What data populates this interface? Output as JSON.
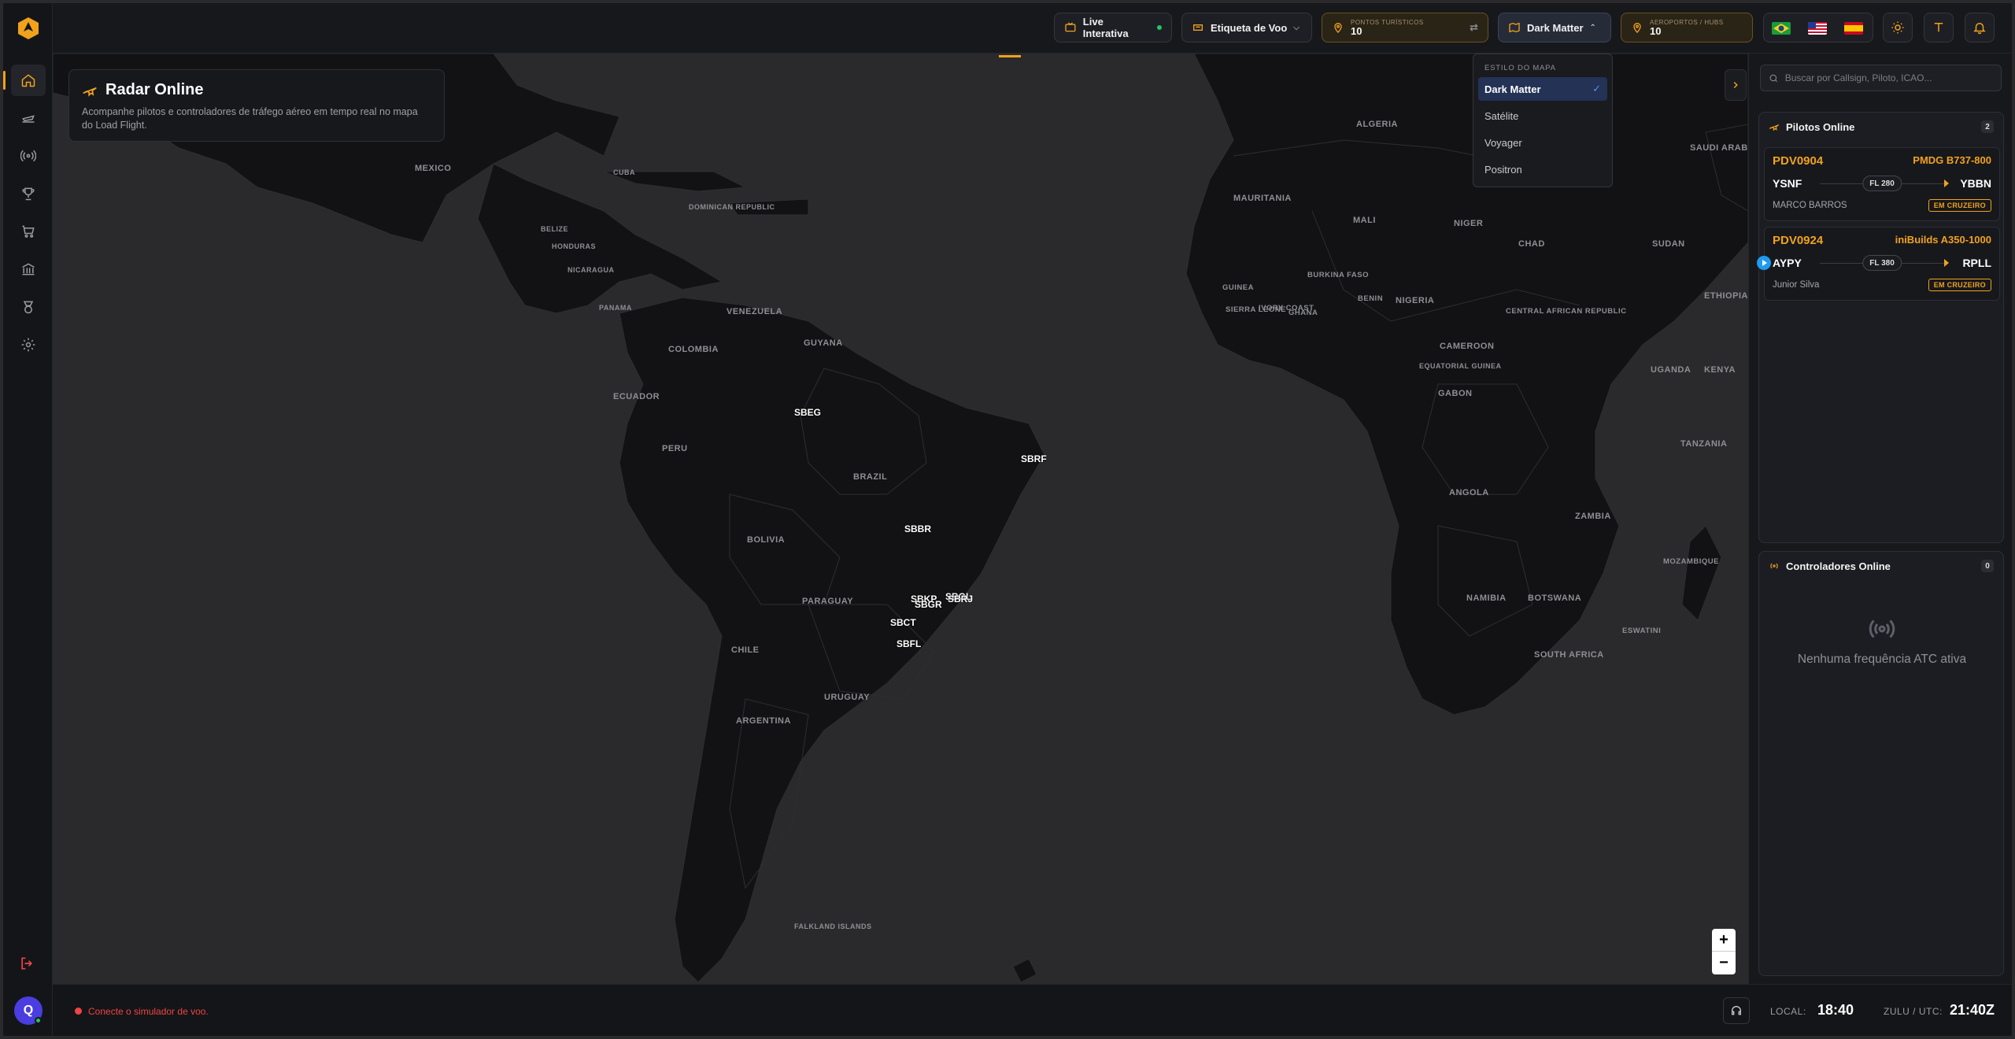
{
  "topbar": {
    "live_label": "Live Interativa",
    "tag_label": "Etiqueta de Voo",
    "tourist_label": "PONTOS TURÍSTICOS",
    "tourist_count": "10",
    "map_style_label": "Dark Matter",
    "airports_label": "AEROPORTOS / HUBS",
    "airports_count": "10"
  },
  "map_style_menu": {
    "header": "ESTILO DO MAPA",
    "options": [
      "Dark Matter",
      "Satélite",
      "Voyager",
      "Positron"
    ],
    "selected": "Dark Matter"
  },
  "radar": {
    "title": "Radar Online",
    "description": "Acompanhe pilotos e controladores de tráfego aéreo em tempo real no mapa do Load Flight."
  },
  "map_labels": [
    "MEXICO",
    "CUBA",
    "DOMINICAN REPUBLIC",
    "BELIZE",
    "HONDURAS",
    "NICARAGUA",
    "PANAMA",
    "VENEZUELA",
    "GUYANA",
    "COLOMBIA",
    "ECUADOR",
    "PERU",
    "BRAZIL",
    "BOLIVIA",
    "PARAGUAY",
    "CHILE",
    "URUGUAY",
    "ARGENTINA",
    "FALKLAND ISLANDS",
    "ALGERIA",
    "MAURITANIA",
    "MALI",
    "NIGER",
    "CHAD",
    "SUDAN",
    "ETHIOPIA",
    "SAUDI ARAB",
    "BURKINA FASO",
    "GUINEA",
    "SIERRA LEONE",
    "IVORY COAST",
    "GHANA",
    "BENIN",
    "NIGERIA",
    "CENTRAL AFRICAN REPUBLIC",
    "CAMEROON",
    "EQUATORIAL GUINEA",
    "GABON",
    "UGANDA",
    "KENYA",
    "TANZANIA",
    "ANGOLA",
    "ZAMBIA",
    "MOZAMBIQUE",
    "NAMIBIA",
    "BOTSWANA",
    "ESWATINI",
    "SOUTH AFRICA"
  ],
  "airports": [
    "SBEG",
    "SBRF",
    "SBBR",
    "SBKP",
    "SBGR",
    "SBGL",
    "SBRJ",
    "SBCT",
    "SBFL"
  ],
  "search": {
    "placeholder": "Buscar por Callsign, Piloto, ICAO..."
  },
  "pilots_box": {
    "title": "Pilotos Online",
    "count": "2",
    "pilots": [
      {
        "callsign": "PDV0904",
        "aircraft": "PMDG B737-800",
        "from": "YSNF",
        "to": "YBBN",
        "fl": "FL 280",
        "name": "MARCO BARROS",
        "status": "EM CRUZEIRO"
      },
      {
        "callsign": "PDV0924",
        "aircraft": "iniBuilds A350-1000",
        "from": "AYPY",
        "to": "RPLL",
        "fl": "FL 380",
        "name": "Junior Silva",
        "status": "EM CRUZEIRO"
      }
    ]
  },
  "atc_box": {
    "title": "Controladores Online",
    "count": "0",
    "empty": "Nenhuma frequência ATC ativa"
  },
  "statusbar": {
    "sim_status": "Conecte o simulador de voo.",
    "local_label": "LOCAL:",
    "local_time": "18:40",
    "zulu_label": "ZULU / UTC:",
    "zulu_time": "21:40Z"
  },
  "user": {
    "initial": "Q"
  },
  "colors": {
    "accent": "#f0a21c",
    "error": "#ef4444",
    "select": "#233255"
  }
}
